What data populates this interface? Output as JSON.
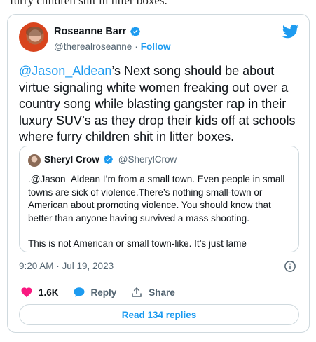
{
  "page": {
    "top_text": "furry children shit in litter boxes."
  },
  "tweet": {
    "author": {
      "display_name": "Roseanne Barr",
      "handle": "@therealroseanne",
      "separator": "·",
      "follow_label": "Follow"
    },
    "text_mention": "@Jason_Aldean",
    "text_body": "’s Next song should be about virtue signaling white women freaking out over a country song while  blasting gangster rap in their luxury SUV’s as they drop their kids off at schools where furry children shit in litter boxes.",
    "quoted": {
      "display_name": "Sheryl Crow",
      "handle": "@SherylCrow",
      "paragraph_1": ".@Jason_Aldean I’m from a small town. Even people in small towns are sick of violence.There’s nothing small-town or American about promoting violence. You should know that better than anyone having survived a mass shooting.",
      "paragraph_2": "This is not American or small town-like. It’s just lame"
    },
    "timestamp": "9:20 AM · Jul 19, 2023",
    "actions": {
      "like_count": "1.6K",
      "reply_label": "Reply",
      "share_label": "Share"
    },
    "read_replies_label": "Read 134 replies"
  },
  "colors": {
    "accent": "#1d9bf0",
    "like": "#f91880",
    "secondary_text": "#536471",
    "border": "#cfd9de"
  },
  "icons": {
    "logo": "twitter-bird-icon",
    "verified": "verified-badge-icon",
    "like": "heart-icon",
    "reply": "speech-bubble-icon",
    "share": "share-arrow-icon",
    "info": "info-icon"
  }
}
